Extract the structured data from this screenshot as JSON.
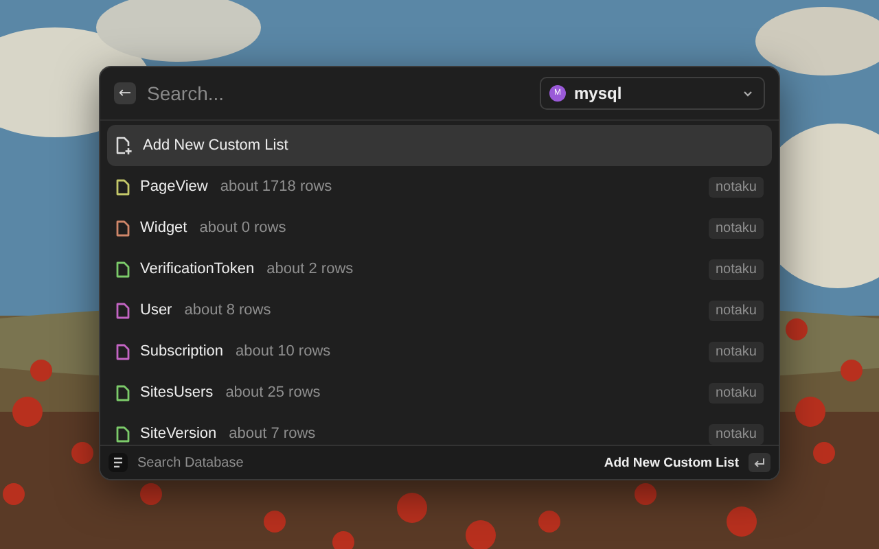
{
  "header": {
    "back": "←",
    "search": {
      "placeholder": "Search..."
    },
    "database": {
      "avatar": "M",
      "name": "mysql"
    }
  },
  "items": [
    {
      "kind": "action",
      "label": "Add New Custom List",
      "selected": true
    },
    {
      "kind": "table",
      "label": "PageView",
      "rows": "about 1718 rows",
      "tag": "notaku",
      "color": "#c5c96a",
      "selected": false
    },
    {
      "kind": "table",
      "label": "Widget",
      "rows": "about 0 rows",
      "tag": "notaku",
      "color": "#d0876a",
      "selected": false
    },
    {
      "kind": "table",
      "label": "VerificationToken",
      "rows": "about 2 rows",
      "tag": "notaku",
      "color": "#7ccb6a",
      "selected": false
    },
    {
      "kind": "table",
      "label": "User",
      "rows": "about 8 rows",
      "tag": "notaku",
      "color": "#c465c4",
      "selected": false
    },
    {
      "kind": "table",
      "label": "Subscription",
      "rows": "about 10 rows",
      "tag": "notaku",
      "color": "#c465c4",
      "selected": false
    },
    {
      "kind": "table",
      "label": "SitesUsers",
      "rows": "about 25 rows",
      "tag": "notaku",
      "color": "#7ccb6a",
      "selected": false
    },
    {
      "kind": "table",
      "label": "SiteVersion",
      "rows": "about 7 rows",
      "tag": "notaku",
      "color": "#7ccb6a",
      "selected": false
    }
  ],
  "footer": {
    "label": "Search Database",
    "action": "Add New Custom List"
  }
}
